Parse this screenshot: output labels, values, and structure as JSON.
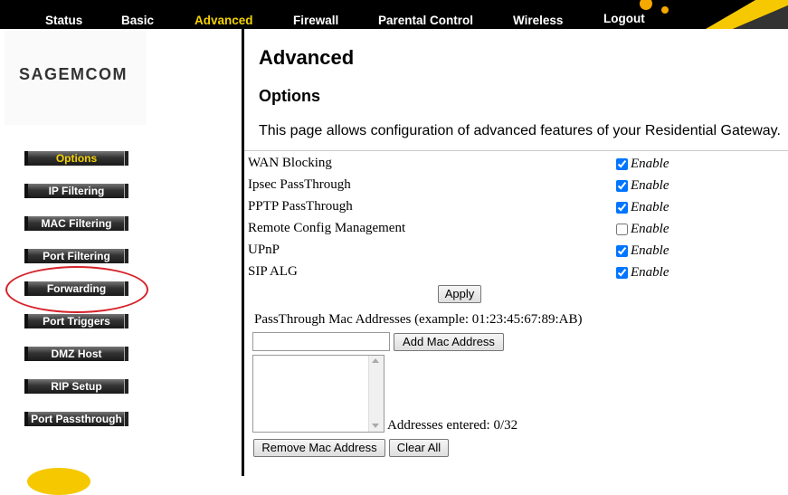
{
  "nav": {
    "tabs": [
      {
        "label": "Status"
      },
      {
        "label": "Basic"
      },
      {
        "label": "Advanced"
      },
      {
        "label": "Firewall"
      },
      {
        "label": "Parental Control"
      },
      {
        "label": "Wireless"
      },
      {
        "label": "Logout"
      }
    ],
    "active_color": "#f5d200"
  },
  "brand": {
    "logo_text": "SAGEMCOM",
    "accent_color": "#f5c800"
  },
  "sidebar": {
    "items": [
      {
        "label": "Options",
        "active": true
      },
      {
        "label": "IP Filtering"
      },
      {
        "label": "MAC Filtering"
      },
      {
        "label": "Port Filtering"
      },
      {
        "label": "Forwarding",
        "circled": true
      },
      {
        "label": "Port Triggers"
      },
      {
        "label": "DMZ Host"
      },
      {
        "label": "RIP Setup"
      },
      {
        "label": "Port Passthrough"
      }
    ],
    "highlight_color": "#d6232a"
  },
  "main": {
    "heading": "Advanced",
    "section": "Options",
    "description": "This page allows configuration of advanced features of your Residential Gateway.",
    "enable_label": "Enable",
    "options": [
      {
        "label": "WAN Blocking",
        "checked": true
      },
      {
        "label": "Ipsec PassThrough",
        "checked": true
      },
      {
        "label": "PPTP PassThrough",
        "checked": true
      },
      {
        "label": "Remote Config Management",
        "checked": false
      },
      {
        "label": "UPnP",
        "checked": true
      },
      {
        "label": "SIP ALG",
        "checked": true
      }
    ],
    "apply_label": "Apply",
    "passthrough": {
      "label": "PassThrough Mac Addresses (example: 01:23:45:67:89:AB)",
      "input_value": "",
      "add_label": "Add Mac Address",
      "addresses": [],
      "count_text": "Addresses entered: 0/32",
      "remove_label": "Remove Mac Address",
      "clear_label": "Clear All"
    }
  }
}
